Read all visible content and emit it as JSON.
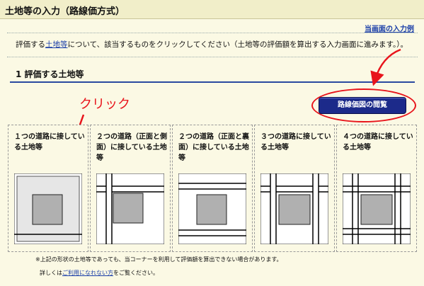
{
  "header": {
    "title": "土地等の入力（路線価方式）"
  },
  "sample_link": "当画面の入力例",
  "intro": {
    "prefix": "評価する",
    "link": "土地等",
    "suffix": "について、該当するものをクリックしてください（土地等の評価額を算出する入力画面に進みます。）。"
  },
  "section": {
    "title": "1  評価する土地等"
  },
  "map_button": "路線価図の閲覧",
  "annotation": {
    "click_label": "クリック",
    "color": "#e8141b"
  },
  "cards": [
    {
      "label": "１つの道路に接している土地等",
      "roads": 1
    },
    {
      "label": "２つの道路（正面と側面）に接している土地等",
      "roads": 2
    },
    {
      "label": "２つの道路（正面と裏面）に接している土地等",
      "roads": 2
    },
    {
      "label": "３つの道路に接している土地等",
      "roads": 3
    },
    {
      "label": "４つの道路に接している土地等",
      "roads": 4
    }
  ],
  "note": "※上記の形状の土地等であっても、当コーナーを利用して評価額を算出できない場合があります。",
  "detail": {
    "prefix": "詳しくは",
    "link": "ご利用になれない方",
    "suffix": "をご覧ください。"
  }
}
